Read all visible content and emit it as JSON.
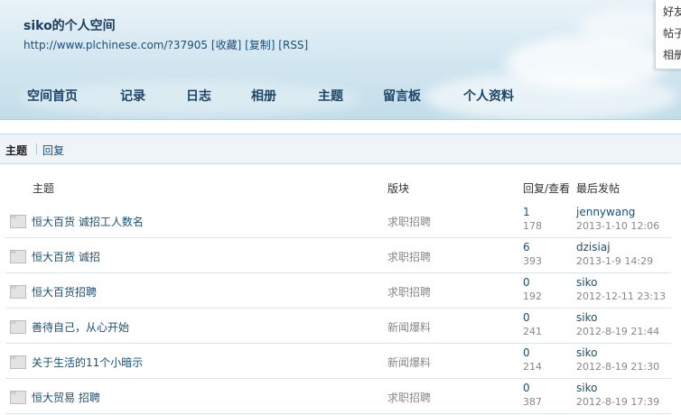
{
  "header": {
    "title": "siko的个人空间",
    "url": "http://www.plchinese.com/?37905",
    "links": [
      "[收藏]",
      "[复制]",
      "[RSS]"
    ]
  },
  "nav": [
    "空间首页",
    "记录",
    "日志",
    "相册",
    "主题",
    "留言板",
    "个人资料"
  ],
  "dropdown": [
    "好友",
    "帖子",
    "相册"
  ],
  "tabs": {
    "active": "主题",
    "other": "回复"
  },
  "table": {
    "headers": {
      "subject": "主题",
      "forum": "版块",
      "reply_view": "回复/查看",
      "last_post": "最后发帖"
    },
    "rows": [
      {
        "subject": "恒大百货 诚招工人数名",
        "forum": "求职招聘",
        "replies": "1",
        "views": "178",
        "author": "jennywang",
        "time": "2013-1-10 12:06"
      },
      {
        "subject": "恒大百货 诚招",
        "forum": "求职招聘",
        "replies": "6",
        "views": "393",
        "author": "dzisiaj",
        "time": "2013-1-9 14:29"
      },
      {
        "subject": "恒大百货招聘",
        "forum": "求职招聘",
        "replies": "0",
        "views": "192",
        "author": "siko",
        "time": "2012-12-11 23:13"
      },
      {
        "subject": "善待自己，从心开始",
        "forum": "新闻爆料",
        "replies": "0",
        "views": "241",
        "author": "siko",
        "time": "2012-8-19 21:44"
      },
      {
        "subject": "关于生活的11个小暗示",
        "forum": "新闻爆料",
        "replies": "0",
        "views": "214",
        "author": "siko",
        "time": "2012-8-19 21:30"
      },
      {
        "subject": "恒大贸易 招聘",
        "forum": "求职招聘",
        "replies": "0",
        "views": "387",
        "author": "siko",
        "time": "2012-8-19 17:39"
      }
    ]
  }
}
